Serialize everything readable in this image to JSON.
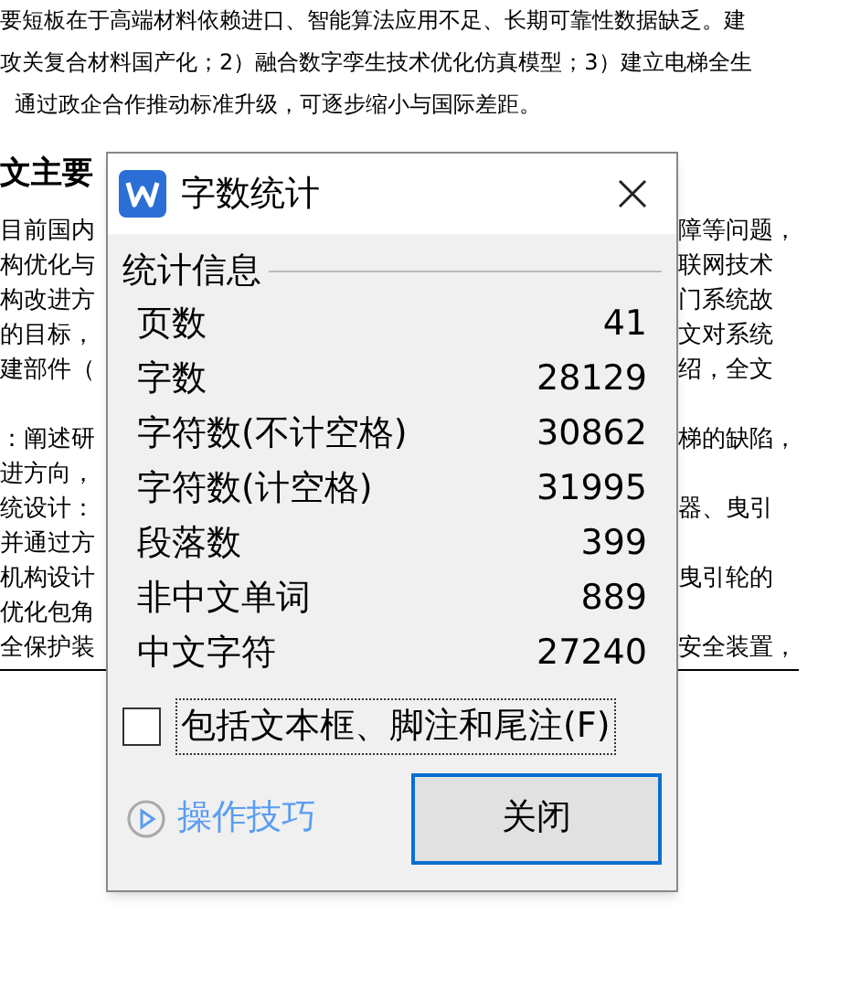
{
  "document": {
    "top_lines": [
      "要短板在于高端材料依赖进口、智能算法应用不足、长期可靠性数据缺乏。建",
      "攻关复合材料国产化；2）融合数字孪生技术优化仿真模型；3）建立电梯全生",
      "通过政企合作推动标准升级，可逐步缩小与国际差距。"
    ],
    "heading": "文主要",
    "rows": [
      {
        "left": "目前国内",
        "right": "障等问题，"
      },
      {
        "left": "构优化与",
        "right": "联网技术"
      },
      {
        "left": "构改进方",
        "right": "门系统故"
      },
      {
        "left": "的目标，",
        "right": "文对系统"
      },
      {
        "left": "建部件（",
        "right": "绍，全文"
      },
      {
        "left": "",
        "right": ""
      },
      {
        "left": "：阐述研",
        "right": "梯的缺陷，"
      },
      {
        "left": "进方向，",
        "right": ""
      },
      {
        "left": "统设计：",
        "right": "器、曳引"
      },
      {
        "left": "并通过方",
        "right": ""
      },
      {
        "left": "机构设计",
        "right": "曳引轮的"
      },
      {
        "left": "优化包角",
        "right": ""
      },
      {
        "left": "全保护装",
        "right": "安全装置，"
      }
    ]
  },
  "dialog": {
    "title": "字数统计",
    "group_label": "统计信息",
    "stats": [
      {
        "label": "页数",
        "value": "41"
      },
      {
        "label": "字数",
        "value": "28129"
      },
      {
        "label": "字符数(不计空格)",
        "value": "30862"
      },
      {
        "label": "字符数(计空格)",
        "value": "31995"
      },
      {
        "label": "段落数",
        "value": "399"
      },
      {
        "label": "非中文单词",
        "value": "889"
      },
      {
        "label": "中文字符",
        "value": "27240"
      }
    ],
    "checkbox": {
      "label": "包括文本框、脚注和尾注(F)",
      "checked": false
    },
    "tips_link": "操作技巧",
    "close_button": "关闭"
  }
}
